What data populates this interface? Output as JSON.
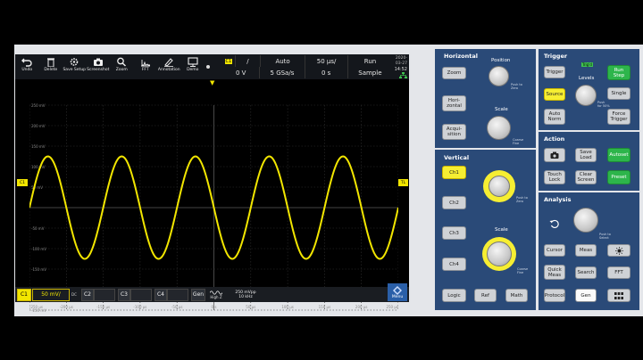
{
  "toolbar": {
    "buttons": [
      {
        "label": "Undo"
      },
      {
        "label": "Delete"
      },
      {
        "label": "Save Setup"
      },
      {
        "label": "Screenshot"
      },
      {
        "label": "Zoom"
      },
      {
        "label": "FFT"
      },
      {
        "label": "Annotation"
      },
      {
        "label": "Demo"
      }
    ]
  },
  "info": {
    "ch_badge": "C1",
    "slope": "/",
    "mode": "Auto",
    "timebase": "50 µs/",
    "run_state": "Run",
    "level": "0 V",
    "sample_rate": "5 GSa/s",
    "offset": "0 s",
    "acq_mode": "Sample",
    "date": "2020-03-27",
    "time": "14:52"
  },
  "grid": {
    "y_labels": [
      "250 mV",
      "200 mV",
      "150 mV",
      "100 mV",
      "50 mV",
      "",
      "-50 mV",
      "-100 mV",
      "-150 mV",
      "-200 mV",
      "-250 mV"
    ],
    "x_labels": [
      "-250 µs",
      "-200 µs",
      "-150 µs",
      "-100 µs",
      "-50 µs",
      "0 s",
      "50 µs",
      "100 µs",
      "150 µs",
      "200 µs",
      "250 µs"
    ],
    "left_marker": "C1",
    "right_marker": "TL",
    "trace_color": "#f2e600"
  },
  "bottom": {
    "c1": "C1",
    "c1_scale": "50 mV/",
    "dc": "DC",
    "c2": "C2",
    "c3": "C3",
    "c4": "C4",
    "gen": "Gen",
    "gen_mode": "High Z",
    "gen_amp": "250 mVpp",
    "gen_freq": "10 kHz",
    "menu": "Menu"
  },
  "panel": {
    "horizontal": {
      "title": "Horizontal",
      "zoom": "Zoom",
      "horizontal": "Hori- zontal",
      "acquisition": "Acqui- sition",
      "position": "Position",
      "scale": "Scale",
      "push_zero": "Push to Zero",
      "coarse_fine": "Coarse Fine"
    },
    "vertical": {
      "title": "Vertical",
      "ch1": "Ch1",
      "ch2": "Ch2",
      "ch3": "Ch3",
      "ch4": "Ch4",
      "logic": "Logic",
      "ref": "Ref",
      "math": "Math",
      "scale": "Scale",
      "push_zero": "Push to Zero",
      "coarse_fine": "Coarse Fine"
    },
    "trigger": {
      "title": "Trigger",
      "trigger": "Trigger",
      "trig_d": "Trig'd",
      "run_step": "Run Step",
      "levels": "Levels",
      "single": "Single",
      "source": "Source",
      "auto_norm": "Auto Norm",
      "force_trigger": "Force Trigger",
      "push_50": "Push for 50%"
    },
    "action": {
      "title": "Action",
      "save_load": "Save Load",
      "autoset": "Autoset",
      "touch_lock": "Touch Lock",
      "clear_screen": "Clear Screen",
      "preset": "Preset"
    },
    "analysis": {
      "title": "Analysis",
      "push_select": "Push to Select",
      "cursor": "Cursor",
      "meas": "Meas",
      "quick_meas": "Quick Meas",
      "search": "Search",
      "fft": "FFT",
      "protocol": "Protocol",
      "gen": "Gen"
    }
  }
}
